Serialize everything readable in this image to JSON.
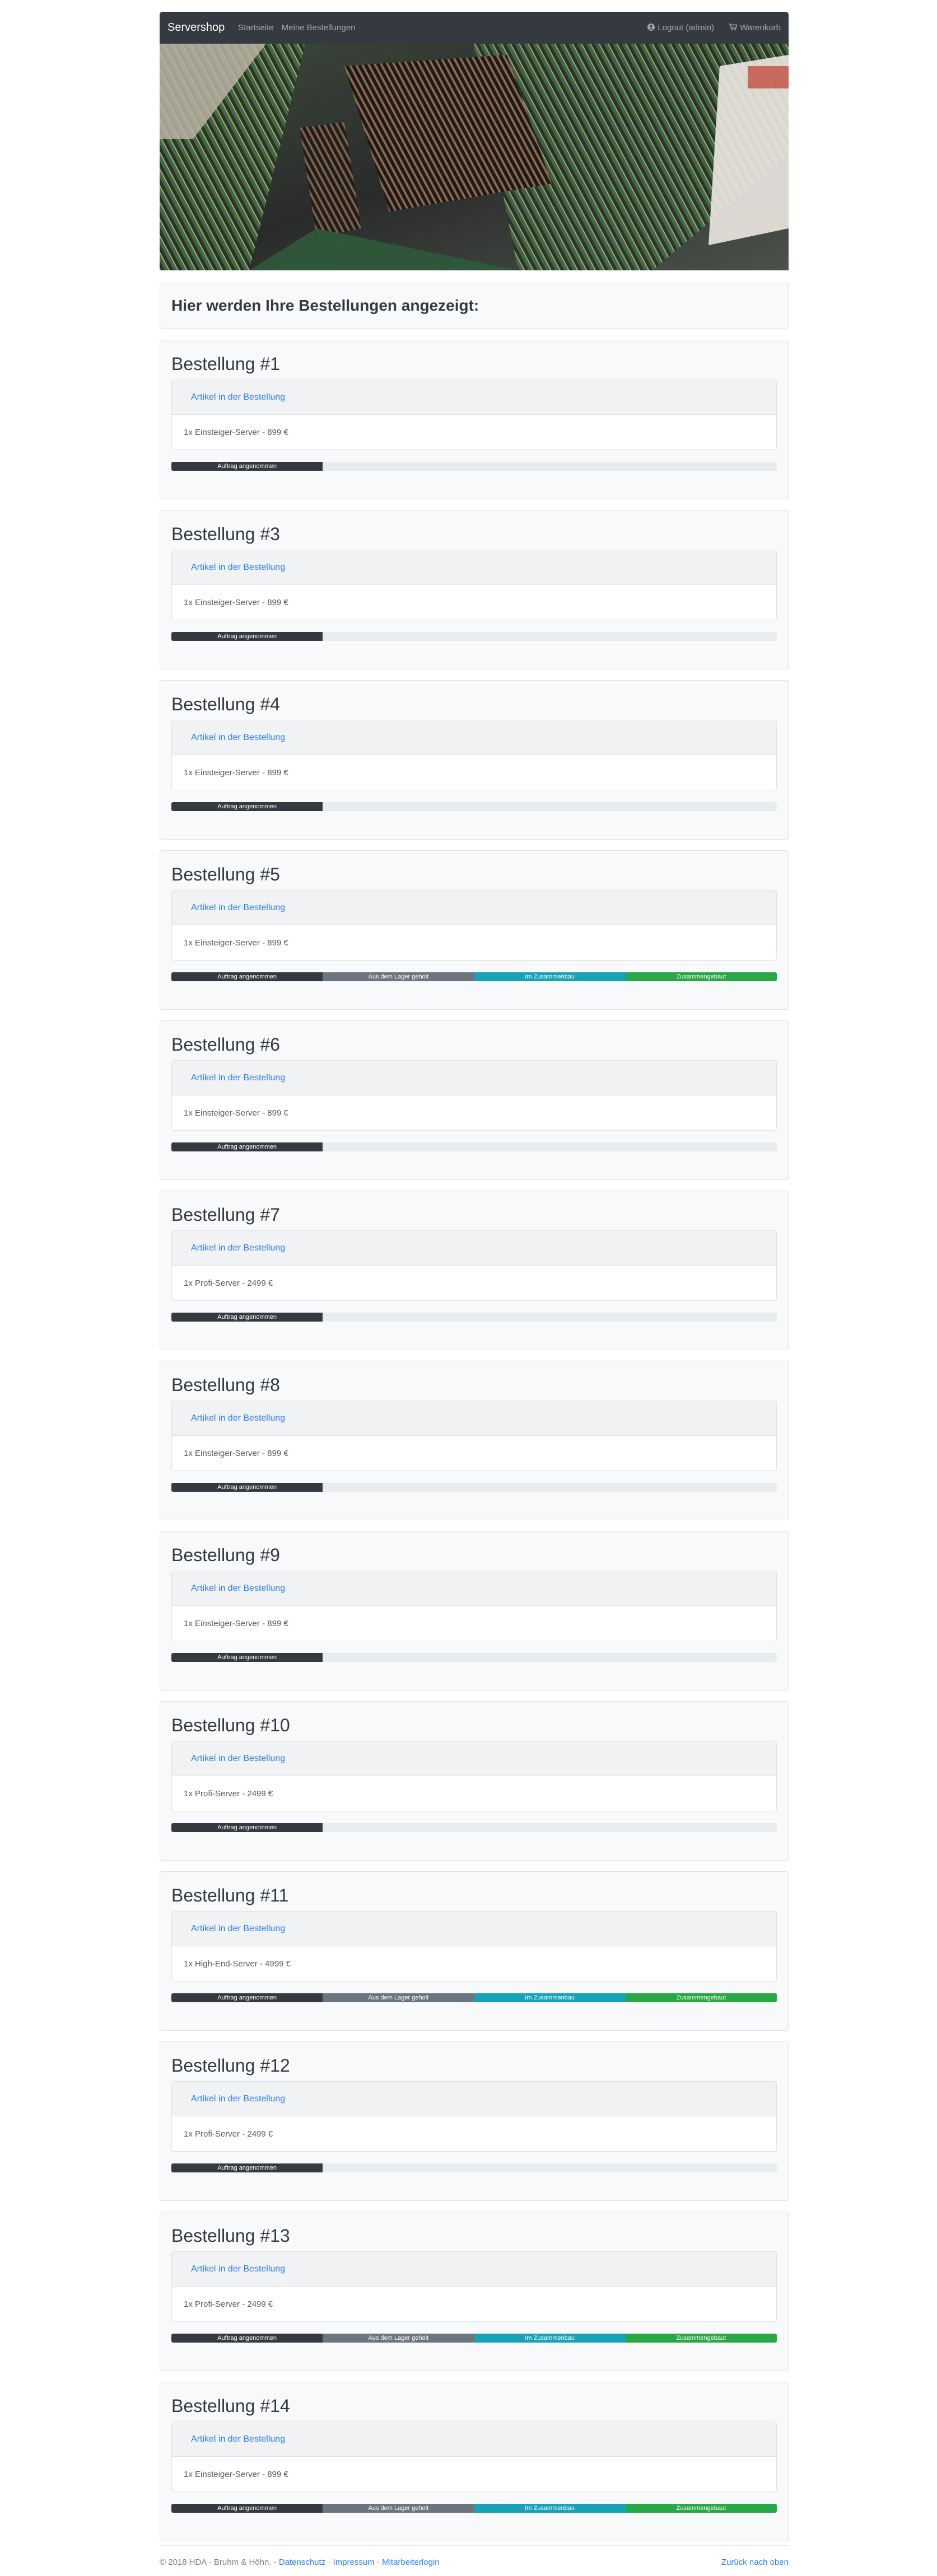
{
  "navbar": {
    "brand": "Servershop",
    "links": [
      "Startseite",
      "Meine Bestellungen"
    ],
    "logout": "Logout (admin)",
    "logout_icon": "user-icon",
    "cart": "Warenkorb",
    "cart_icon": "cart-icon"
  },
  "hero": {
    "image": "server-motherboard-photo"
  },
  "heading": "Hier werden Ihre Bestellungen angezeigt:",
  "items_header_label": "Artikel in der Bestellung",
  "status_steps": [
    "Auftrag angenommen",
    "Aus dem Lager geholt",
    "Im Zusammenbau",
    "Zusammengebaut"
  ],
  "colors": {
    "step1": "#343a40",
    "step2": "#6c757d",
    "step3": "#17a2b8",
    "step4": "#28a745",
    "link": "#2f7ef0"
  },
  "orders": [
    {
      "title": "Bestellung #1",
      "item": "1x Einsteiger-Server - 899 €",
      "steps_done": 1
    },
    {
      "title": "Bestellung #3",
      "item": "1x Einsteiger-Server - 899 €",
      "steps_done": 1
    },
    {
      "title": "Bestellung #4",
      "item": "1x Einsteiger-Server - 899 €",
      "steps_done": 1
    },
    {
      "title": "Bestellung #5",
      "item": "1x Einsteiger-Server - 899 €",
      "steps_done": 4
    },
    {
      "title": "Bestellung #6",
      "item": "1x Einsteiger-Server - 899 €",
      "steps_done": 1
    },
    {
      "title": "Bestellung #7",
      "item": "1x Profi-Server - 2499 €",
      "steps_done": 1
    },
    {
      "title": "Bestellung #8",
      "item": "1x Einsteiger-Server - 899 €",
      "steps_done": 1
    },
    {
      "title": "Bestellung #9",
      "item": "1x Einsteiger-Server - 899 €",
      "steps_done": 1
    },
    {
      "title": "Bestellung #10",
      "item": "1x Profi-Server - 2499 €",
      "steps_done": 1
    },
    {
      "title": "Bestellung #11",
      "item": "1x High-End-Server - 4999 €",
      "steps_done": 4
    },
    {
      "title": "Bestellung #12",
      "item": "1x Profi-Server - 2499 €",
      "steps_done": 1
    },
    {
      "title": "Bestellung #13",
      "item": "1x Profi-Server - 2499 €",
      "steps_done": 4
    },
    {
      "title": "Bestellung #14",
      "item": "1x Einsteiger-Server - 899 €",
      "steps_done": 4
    }
  ],
  "footer": {
    "copyright": "© 2018 HDA - Bruhm & Höhn. -",
    "links": [
      "Datenschutz",
      "Impressum",
      "Mitarbeiterlogin"
    ],
    "separator": "·",
    "back_to_top": "Zurück nach oben"
  }
}
